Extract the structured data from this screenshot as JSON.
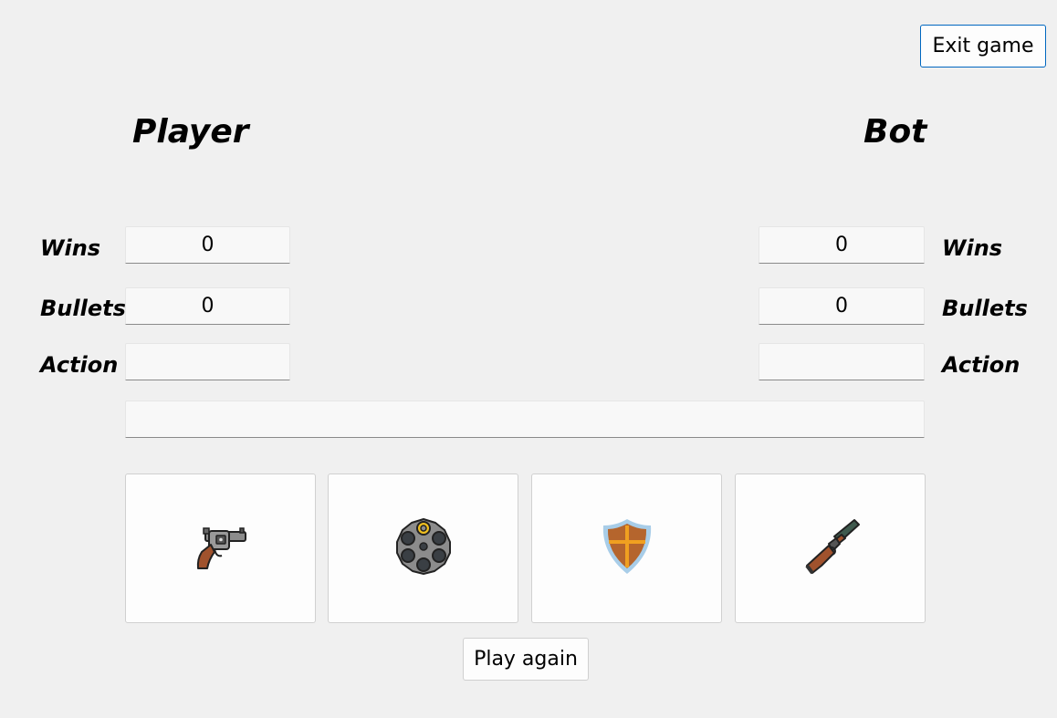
{
  "toolbar": {
    "exit_label": "Exit game"
  },
  "player": {
    "title": "Player",
    "wins_label": "Wins",
    "wins": "0",
    "bullets_label": "Bullets",
    "bullets": "0",
    "action_label": "Action",
    "action": ""
  },
  "bot": {
    "title": "Bot",
    "wins_label": "Wins",
    "wins": "0",
    "bullets_label": "Bullets",
    "bullets": "0",
    "action_label": "Action",
    "action": ""
  },
  "result": {
    "text": ""
  },
  "actions": [
    {
      "icon": "revolver-icon"
    },
    {
      "icon": "revolver-cylinder-icon"
    },
    {
      "icon": "shield-icon"
    },
    {
      "icon": "shotgun-icon"
    }
  ],
  "footer": {
    "play_again_label": "Play again"
  },
  "colors": {
    "background": "#f0f0f0",
    "exit_border": "#0067c0",
    "wood": "#a0522d",
    "metal": "#8c8c8c",
    "shield_fill": "#b5652d",
    "shield_rim": "#a8cde8",
    "cross": "#f0a020"
  }
}
